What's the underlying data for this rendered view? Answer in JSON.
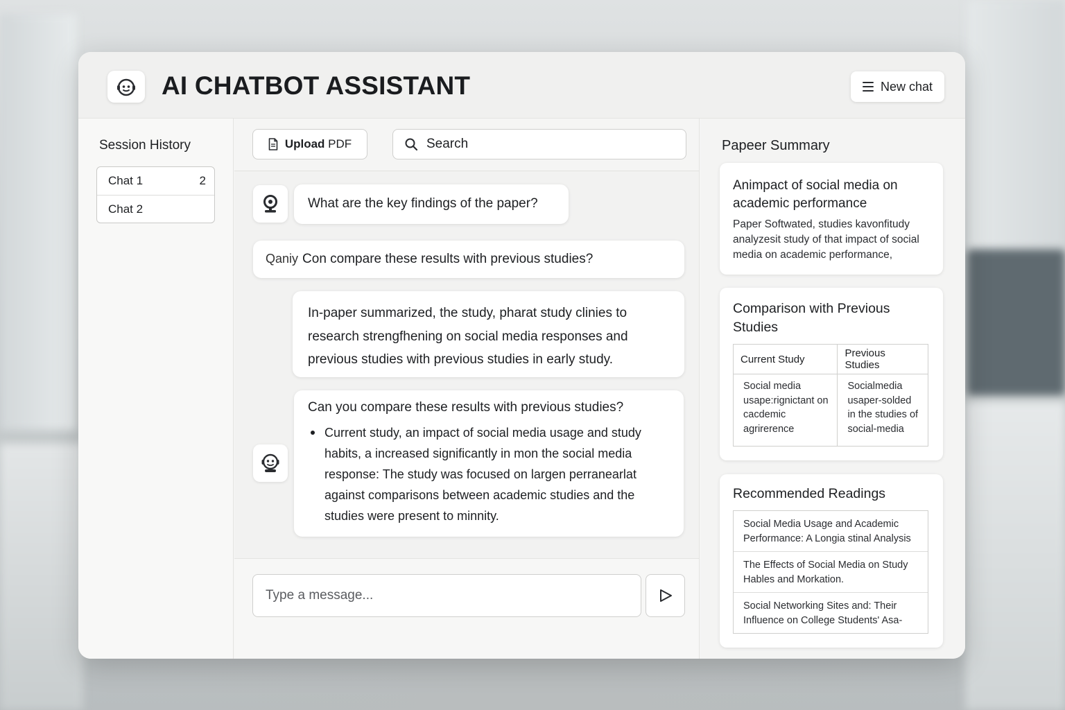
{
  "header": {
    "title": "AI CHATBOT ASSISTANT",
    "new_chat_label": "New chat"
  },
  "sidebar": {
    "title": "Session History",
    "items": [
      {
        "label": "Chat 1",
        "count": "2"
      },
      {
        "label": "Chat 2",
        "count": ""
      }
    ]
  },
  "toolbar": {
    "upload_bold": "Upload",
    "upload_rest": "PDF",
    "search_placeholder": "Search"
  },
  "messages": [
    {
      "text": "What are the key findings of the paper?"
    },
    {
      "prefix": "Qaniy",
      "text": "Con compare these results with previous studies?"
    },
    {
      "text": "In-paper summarized, the study, pharat study clinies to research strengfhening on social media responses and previous studies with previous studies in early study."
    },
    {
      "text": "Can you compare these results with previous studies?",
      "bullet": "Current study, an impact of social media usage and study habits, a increased significantly in mon the social media response: The study was focused on largen perranearlat against comparisons between academic studies and the studies were present to minnity."
    }
  ],
  "composer": {
    "placeholder": "Type a message..."
  },
  "right_panel": {
    "title": "Papeer Summary",
    "summary": {
      "heading": "Animpact of social media on academic performance",
      "body": "Paper Softwated, studies kavonfitudy analyzesit study of that impact of social media on academic performance,"
    },
    "comparison": {
      "heading": "Comparison with Previous Studies",
      "columns": [
        "Current Study",
        "Previous Studies"
      ],
      "cells": [
        "Social media usape:rignictant on cacdemic agrirerence",
        "Socialmedia usaper-solded in the studies of social-media"
      ]
    },
    "readings": {
      "heading": "Recommended Readings",
      "items": [
        "Social Media Usage and Academic Performance: A Longia stinal Analysis",
        "The Effects of Social Media on Study Hables and Morkation.",
        "Social Networking Sites and: Their Influence on College Students' Asa-"
      ]
    }
  },
  "colors": {
    "panel_bg": "#f6f6f5",
    "card_bg": "#ffffff",
    "border": "#cfcfcd",
    "text": "#1d1f22"
  }
}
